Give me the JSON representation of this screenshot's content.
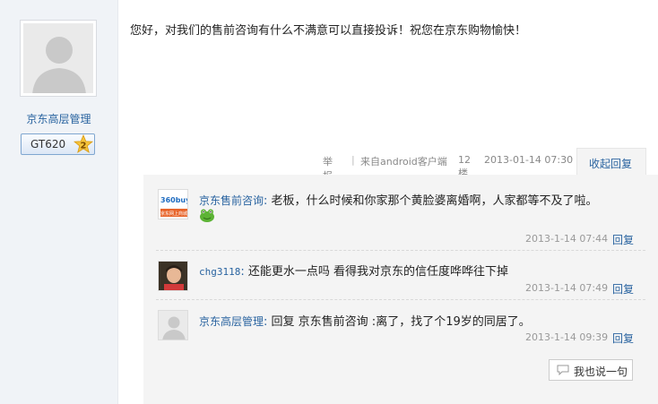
{
  "user": {
    "name": "京东高层管理",
    "badge_label": "GT620",
    "badge_level": "2"
  },
  "post": {
    "content": "您好，对我们的售前咨询有什么不满意可以直接投诉！祝您在京东购物愉快！",
    "report_label": "举报",
    "source_label": "来自android客户端",
    "floor": "12楼",
    "datetime": "2013-01-14 07:30",
    "collapse_reply_label": "收起回复"
  },
  "replies": [
    {
      "name": "京东售前咨询",
      "text": "老板，什么时候和你家那个黄脸婆离婚啊，人家都等不及了啦。",
      "time": "2013-1-14 07:44",
      "reply_label": "回复",
      "avatar_text": "360buy.com",
      "avatar_sub": "京东网上商城"
    },
    {
      "name": "chg3118",
      "text": "还能更水一点吗 看得我对京东的信任度哗哗往下掉",
      "time": "2013-1-14 07:49",
      "reply_label": "回复"
    },
    {
      "name": "京东高层管理",
      "text": "回复 京东售前咨询 :离了，找了个19岁的同居了。",
      "time": "2013-1-14 09:39",
      "reply_label": "回复"
    }
  ],
  "say_button_label": "我也说一句",
  "colors": {
    "link": "#2a64a0",
    "panel": "#f4f4f4",
    "sidebar": "#f0f3f7",
    "badge_star": "#f5c33b"
  }
}
